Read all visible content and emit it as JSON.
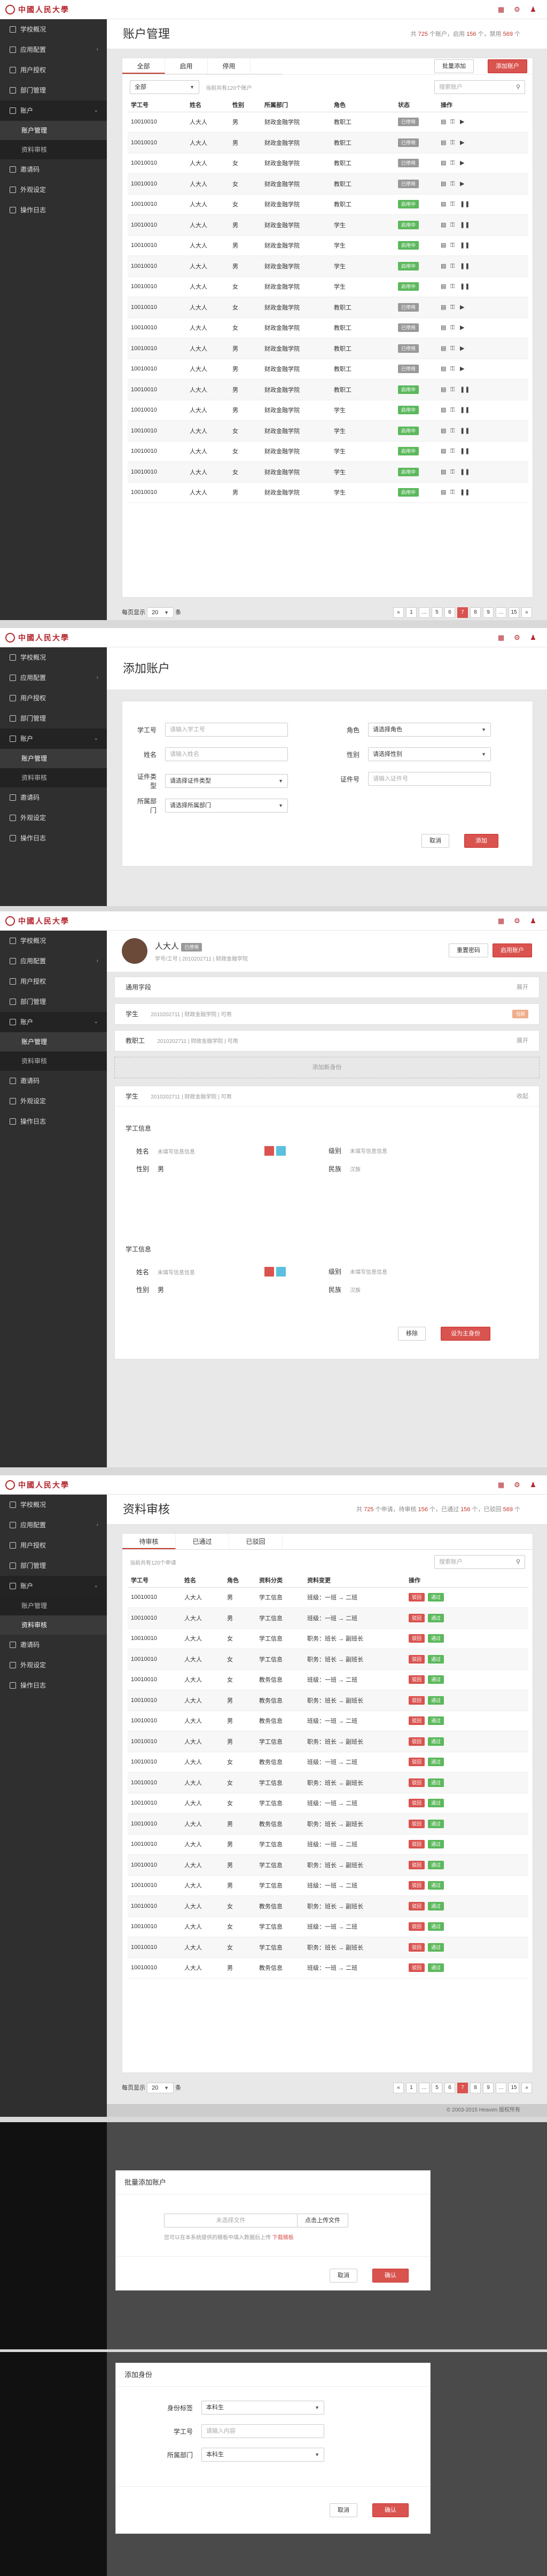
{
  "brand": {
    "name": "中國人民大學"
  },
  "header_icons": [
    "grid-icon",
    "settings-icon",
    "user-icon"
  ],
  "sidebar": {
    "items": [
      {
        "label": "学校概况"
      },
      {
        "label": "应用配置"
      },
      {
        "label": "用户授权"
      },
      {
        "label": "部门管理"
      },
      {
        "label": "账户"
      },
      {
        "label": "账户管理"
      },
      {
        "label": "资料审核"
      },
      {
        "label": "邀请码"
      },
      {
        "label": "外观设定"
      },
      {
        "label": "操作日志"
      }
    ]
  },
  "accounts": {
    "title": "账户管理",
    "stat": {
      "prefix": "共",
      "total": "725",
      "mid": "个账户，启用",
      "enabled": "156",
      "mid2": "个，禁用",
      "disabled": "569",
      "suffix": "个"
    },
    "tabs": [
      "全部",
      "启用",
      "停用"
    ],
    "bulk_add": "批量添加",
    "add_account": "添加账户",
    "filter_select": "全部",
    "filter_hint": "当前共有120个账户",
    "search_placeholder": "搜索账户",
    "columns": [
      "学工号",
      "姓名",
      "性别",
      "所属部门",
      "角色",
      "状态",
      "操作"
    ],
    "rows": [
      [
        "10010010",
        "人大人",
        "男",
        "财政金融学院",
        "教职工",
        "已停用"
      ],
      [
        "10010010",
        "人大人",
        "男",
        "财政金融学院",
        "教职工",
        "已停用"
      ],
      [
        "10010010",
        "人大人",
        "女",
        "财政金融学院",
        "教职工",
        "已停用"
      ],
      [
        "10010010",
        "人大人",
        "女",
        "财政金融学院",
        "教职工",
        "已停用"
      ],
      [
        "10010010",
        "人大人",
        "女",
        "财政金融学院",
        "教职工",
        "启用中"
      ],
      [
        "10010010",
        "人大人",
        "男",
        "财政金融学院",
        "学生",
        "启用中"
      ],
      [
        "10010010",
        "人大人",
        "男",
        "财政金融学院",
        "学生",
        "启用中"
      ],
      [
        "10010010",
        "人大人",
        "男",
        "财政金融学院",
        "学生",
        "启用中"
      ],
      [
        "10010010",
        "人大人",
        "女",
        "财政金融学院",
        "学生",
        "启用中"
      ],
      [
        "10010010",
        "人大人",
        "女",
        "财政金融学院",
        "教职工",
        "已停用"
      ],
      [
        "10010010",
        "人大人",
        "女",
        "财政金融学院",
        "教职工",
        "已停用"
      ],
      [
        "10010010",
        "人大人",
        "男",
        "财政金融学院",
        "教职工",
        "已停用"
      ],
      [
        "10010010",
        "人大人",
        "男",
        "财政金融学院",
        "教职工",
        "已停用"
      ],
      [
        "10010010",
        "人大人",
        "男",
        "财政金融学院",
        "教职工",
        "启用中"
      ],
      [
        "10010010",
        "人大人",
        "男",
        "财政金融学院",
        "学生",
        "启用中"
      ],
      [
        "10010010",
        "人大人",
        "女",
        "财政金融学院",
        "学生",
        "启用中"
      ],
      [
        "10010010",
        "人大人",
        "女",
        "财政金融学院",
        "学生",
        "启用中"
      ],
      [
        "10010010",
        "人大人",
        "女",
        "财政金融学院",
        "学生",
        "启用中"
      ],
      [
        "10010010",
        "人大人",
        "男",
        "财政金融学院",
        "学生",
        "启用中"
      ]
    ],
    "per_page_label": "每页显示",
    "per_page": "20",
    "per_page_unit": "条",
    "pages": [
      "«",
      "1",
      "…",
      "5",
      "6",
      "7",
      "8",
      "9",
      "…",
      "15",
      "»"
    ]
  },
  "add_account": {
    "title": "添加账户",
    "fields": {
      "id_label": "学工号",
      "id_placeholder": "请输入学工号",
      "role_label": "角色",
      "role_value": "请选择角色",
      "name_label": "姓名",
      "name_placeholder": "请输入姓名",
      "gender_label": "性别",
      "gender_value": "请选择性别",
      "idtype_label": "证件类型",
      "idtype_value": "请选择证件类型",
      "idno_label": "证件号",
      "idno_placeholder": "请输入证件号",
      "dept_label": "所属部门",
      "dept_value": "请选择所属部门"
    },
    "cancel": "取消",
    "submit": "添加"
  },
  "profile": {
    "name": "人大人",
    "status": "已停用",
    "sub": "学号/工号 | 2010202711 | 财政金融学院",
    "reset_pwd": "重置密码",
    "enable": "启用账户",
    "s1_title": "通用字段",
    "s1_right": "展开",
    "s2_title": "学生",
    "s2_desc": "2010202711 | 财政金融学院 | 可用",
    "s2_badge": "当前",
    "s3_title": "教职工",
    "s3_desc": "2010202711 | 财政金融学院 | 可用",
    "s3_right": "展开",
    "add_identity": "添加新身份",
    "s4_title": "学生",
    "s4_desc": "2010202711 | 财政金融学院 | 可用",
    "s4_right": "收起",
    "block1_title": "学工信息",
    "block2_title": "学工信息",
    "f_name": "姓名",
    "f_name_v": "未填写信息信息",
    "f_grade": "级别",
    "f_grade_v": "未填写信息信息",
    "f_gender": "性别",
    "f_gender_v": "男",
    "f_nation": "民族",
    "f_nation_v": "汉族",
    "delete": "移除",
    "set_primary": "设为主身份"
  },
  "review": {
    "title": "资料审核",
    "stat": {
      "prefix": "共",
      "total": "725",
      "mid": "个申请，待审核",
      "pending": "156",
      "mid2": "个，已通过",
      "passed": "156",
      "mid3": "个，已驳回",
      "rejected": "569",
      "suffix": "个"
    },
    "tabs": [
      "待审核",
      "已通过",
      "已驳回"
    ],
    "hint": "当前共有120个申请",
    "search_placeholder": "搜索账户",
    "columns": [
      "学工号",
      "姓名",
      "角色",
      "资料分类",
      "资料变更",
      "操作"
    ],
    "reject": "驳回",
    "pass": "通过",
    "rows": [
      [
        "10010010",
        "人大人",
        "男",
        "学工信息",
        "班级：一班 → 二班"
      ],
      [
        "10010010",
        "人大人",
        "男",
        "学工信息",
        "班级：一班 → 二班"
      ],
      [
        "10010010",
        "人大人",
        "女",
        "学工信息",
        "职务：班长 → 副班长"
      ],
      [
        "10010010",
        "人大人",
        "女",
        "学工信息",
        "职务：班长 → 副班长"
      ],
      [
        "10010010",
        "人大人",
        "女",
        "教务信息",
        "班级：一班 → 二班"
      ],
      [
        "10010010",
        "人大人",
        "男",
        "教务信息",
        "职务：班长 → 副班长"
      ],
      [
        "10010010",
        "人大人",
        "男",
        "教务信息",
        "班级：一班 → 二班"
      ],
      [
        "10010010",
        "人大人",
        "男",
        "学工信息",
        "职务：班长 → 副班长"
      ],
      [
        "10010010",
        "人大人",
        "女",
        "教务信息",
        "班级：一班 → 二班"
      ],
      [
        "10010010",
        "人大人",
        "女",
        "学工信息",
        "职务：班长 → 副班长"
      ],
      [
        "10010010",
        "人大人",
        "女",
        "学工信息",
        "班级：一班 → 二班"
      ],
      [
        "10010010",
        "人大人",
        "男",
        "教务信息",
        "职务：班长 → 副班长"
      ],
      [
        "10010010",
        "人大人",
        "男",
        "学工信息",
        "班级：一班 → 二班"
      ],
      [
        "10010010",
        "人大人",
        "男",
        "学工信息",
        "职务：班长 → 副班长"
      ],
      [
        "10010010",
        "人大人",
        "男",
        "学工信息",
        "班级：一班 → 二班"
      ],
      [
        "10010010",
        "人大人",
        "女",
        "教务信息",
        "职务：班长 → 副班长"
      ],
      [
        "10010010",
        "人大人",
        "女",
        "学工信息",
        "班级：一班 → 二班"
      ],
      [
        "10010010",
        "人大人",
        "女",
        "学工信息",
        "职务：班长 → 副班长"
      ],
      [
        "10010010",
        "人大人",
        "男",
        "教务信息",
        "班级：一班 → 二班"
      ]
    ],
    "per_page_label": "每页显示",
    "per_page": "20",
    "per_page_unit": "条",
    "pages": [
      "«",
      "1",
      "…",
      "5",
      "6",
      "7",
      "8",
      "9",
      "…",
      "15",
      "»"
    ],
    "footer": "© 2003-2015 Heaven 版权所有"
  },
  "bulk_modal": {
    "title": "批量添加账户",
    "file_placeholder": "未选择文件",
    "upload": "点击上传文件",
    "hint": "您可以在本系统提供的模板中填入数据后上传",
    "template": "下载模板",
    "cancel": "取消",
    "ok": "确认"
  },
  "identity_modal": {
    "title": "添加身份",
    "f1_label": "身份标签",
    "f1_value": "本科生",
    "f2_label": "学工号",
    "f2_placeholder": "请输入内容",
    "f3_label": "所属部门",
    "f3_value": "本科生",
    "cancel": "取消",
    "ok": "确认"
  }
}
